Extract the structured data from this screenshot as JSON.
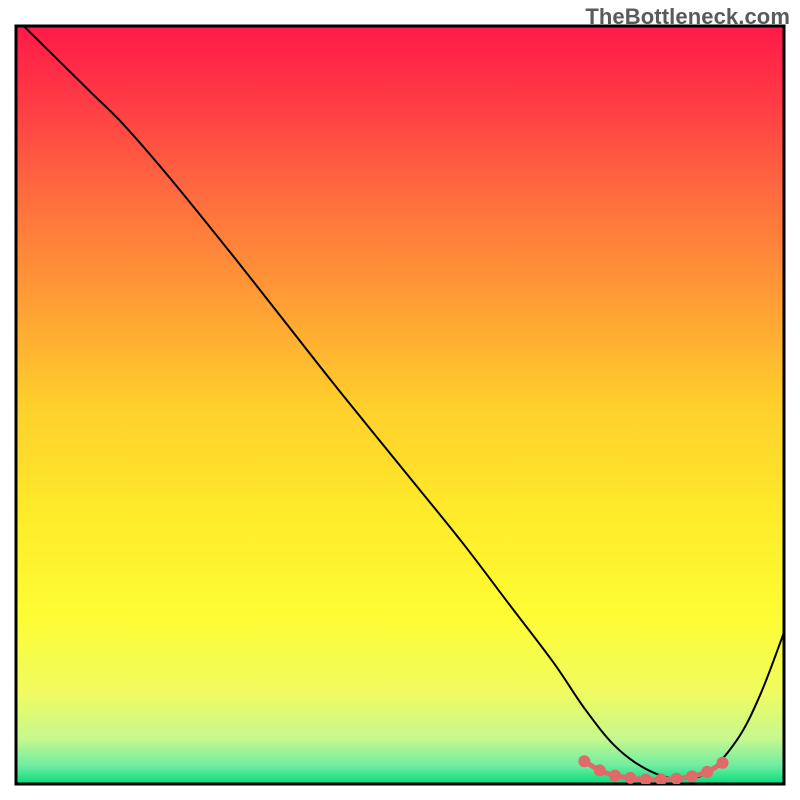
{
  "watermark": "TheBottleneck.com",
  "chart_data": {
    "type": "line",
    "title": "",
    "xlabel": "",
    "ylabel": "",
    "xlim": [
      0,
      100
    ],
    "ylim": [
      0,
      100
    ],
    "grid": false,
    "legend": false,
    "background": {
      "type": "vertical-gradient",
      "stops": [
        {
          "pos": 0.0,
          "color": "#ff1a49"
        },
        {
          "pos": 0.1,
          "color": "#ff3b45"
        },
        {
          "pos": 0.22,
          "color": "#ff6b3f"
        },
        {
          "pos": 0.35,
          "color": "#ff9936"
        },
        {
          "pos": 0.5,
          "color": "#ffcf2c"
        },
        {
          "pos": 0.65,
          "color": "#feec2a"
        },
        {
          "pos": 0.78,
          "color": "#fdfd34"
        },
        {
          "pos": 0.88,
          "color": "#f0fb60"
        },
        {
          "pos": 0.94,
          "color": "#c6f88e"
        },
        {
          "pos": 0.975,
          "color": "#72eda0"
        },
        {
          "pos": 1.0,
          "color": "#07db7d"
        }
      ]
    },
    "series": [
      {
        "name": "bottleneck-curve",
        "color": "#000000",
        "width": 2,
        "x": [
          1,
          5,
          10,
          14,
          20,
          28,
          35,
          42,
          50,
          58,
          64,
          70,
          74,
          78,
          82,
          86,
          90,
          94,
          97,
          100
        ],
        "y": [
          100,
          96,
          91,
          87,
          80,
          70,
          61,
          52,
          42,
          32,
          24,
          16,
          10,
          5,
          2,
          0.7,
          1.5,
          6,
          12,
          20
        ]
      }
    ],
    "highlight": {
      "name": "optimal-band",
      "color": "#e06a6a",
      "marker_size": 6,
      "line_width": 5,
      "x": [
        74,
        76,
        78,
        80,
        82,
        84,
        86,
        88,
        90,
        92
      ],
      "y": [
        3.0,
        1.8,
        1.1,
        0.8,
        0.6,
        0.6,
        0.7,
        1.0,
        1.6,
        2.8
      ]
    },
    "axes_box": {
      "color": "#000000",
      "width": 3
    }
  }
}
